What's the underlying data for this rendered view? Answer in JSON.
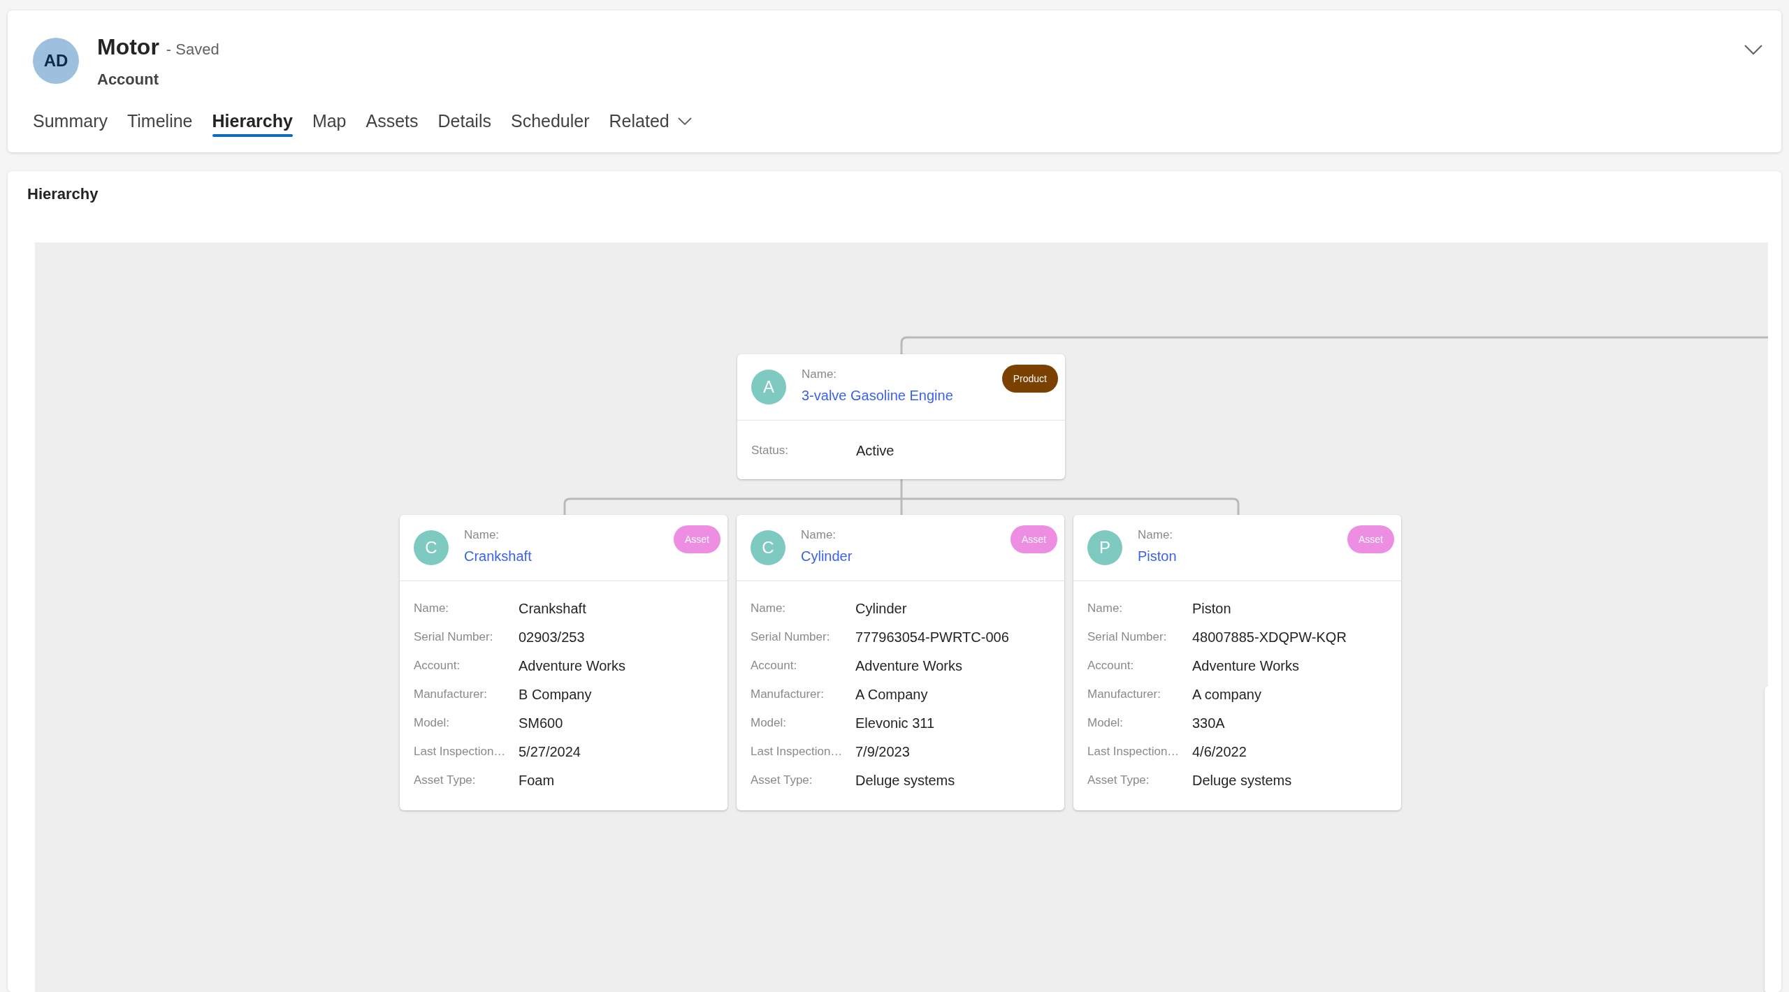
{
  "record": {
    "avatar": "AD",
    "title": "Motor",
    "save_state": "- Saved",
    "entity": "Account"
  },
  "tabs": [
    {
      "label": "Summary",
      "selected": false,
      "kind": "plain"
    },
    {
      "label": "Timeline",
      "selected": false,
      "kind": "plain"
    },
    {
      "label": "Hierarchy",
      "selected": true,
      "kind": "plain"
    },
    {
      "label": "Map",
      "selected": false,
      "kind": "plain"
    },
    {
      "label": "Assets",
      "selected": false,
      "kind": "plain"
    },
    {
      "label": "Details",
      "selected": false,
      "kind": "plain"
    },
    {
      "label": "Scheduler",
      "selected": false,
      "kind": "plain"
    },
    {
      "label": "Related",
      "selected": false,
      "kind": "menu"
    }
  ],
  "section_title": "Hierarchy",
  "root": {
    "avatar": "A",
    "name_label": "Name:",
    "name": "3-valve Gasoline Engine",
    "badge": {
      "label": "Product",
      "color": "#7a4100"
    },
    "fields": [
      {
        "label": "Status:",
        "value": "Active"
      }
    ]
  },
  "children": [
    {
      "avatar": "C",
      "name_label": "Name:",
      "name": "Crankshaft",
      "badge": {
        "label": "Asset",
        "color": "#ee8ee3"
      },
      "fields": [
        {
          "label": "Name:",
          "value": "Crankshaft"
        },
        {
          "label": "Serial Number:",
          "value": "02903/253"
        },
        {
          "label": "Account:",
          "value": "Adventure Works"
        },
        {
          "label": "Manufacturer:",
          "value": "B Company"
        },
        {
          "label": "Model:",
          "value": "SM600"
        },
        {
          "label": "Last Inspection…",
          "value": "5/27/2024"
        },
        {
          "label": "Asset Type:",
          "value": "Foam"
        }
      ]
    },
    {
      "avatar": "C",
      "name_label": "Name:",
      "name": "Cylinder",
      "badge": {
        "label": "Asset",
        "color": "#ee8ee3"
      },
      "fields": [
        {
          "label": "Name:",
          "value": "Cylinder"
        },
        {
          "label": "Serial Number:",
          "value": "777963054-PWRTC-006"
        },
        {
          "label": "Account:",
          "value": "Adventure Works"
        },
        {
          "label": "Manufacturer:",
          "value": "A Company"
        },
        {
          "label": "Model:",
          "value": "Elevonic 311"
        },
        {
          "label": "Last Inspection…",
          "value": "7/9/2023"
        },
        {
          "label": "Asset Type:",
          "value": "Deluge systems"
        }
      ]
    },
    {
      "avatar": "P",
      "name_label": "Name:",
      "name": "Piston",
      "badge": {
        "label": "Asset",
        "color": "#ee8ee3"
      },
      "fields": [
        {
          "label": "Name:",
          "value": "Piston"
        },
        {
          "label": "Serial Number:",
          "value": "48007885-XDQPW-KQR"
        },
        {
          "label": "Account:",
          "value": "Adventure Works"
        },
        {
          "label": "Manufacturer:",
          "value": "A company"
        },
        {
          "label": "Model:",
          "value": "330A"
        },
        {
          "label": "Last Inspection…",
          "value": "4/6/2022"
        },
        {
          "label": "Asset Type:",
          "value": "Deluge systems"
        }
      ]
    }
  ]
}
